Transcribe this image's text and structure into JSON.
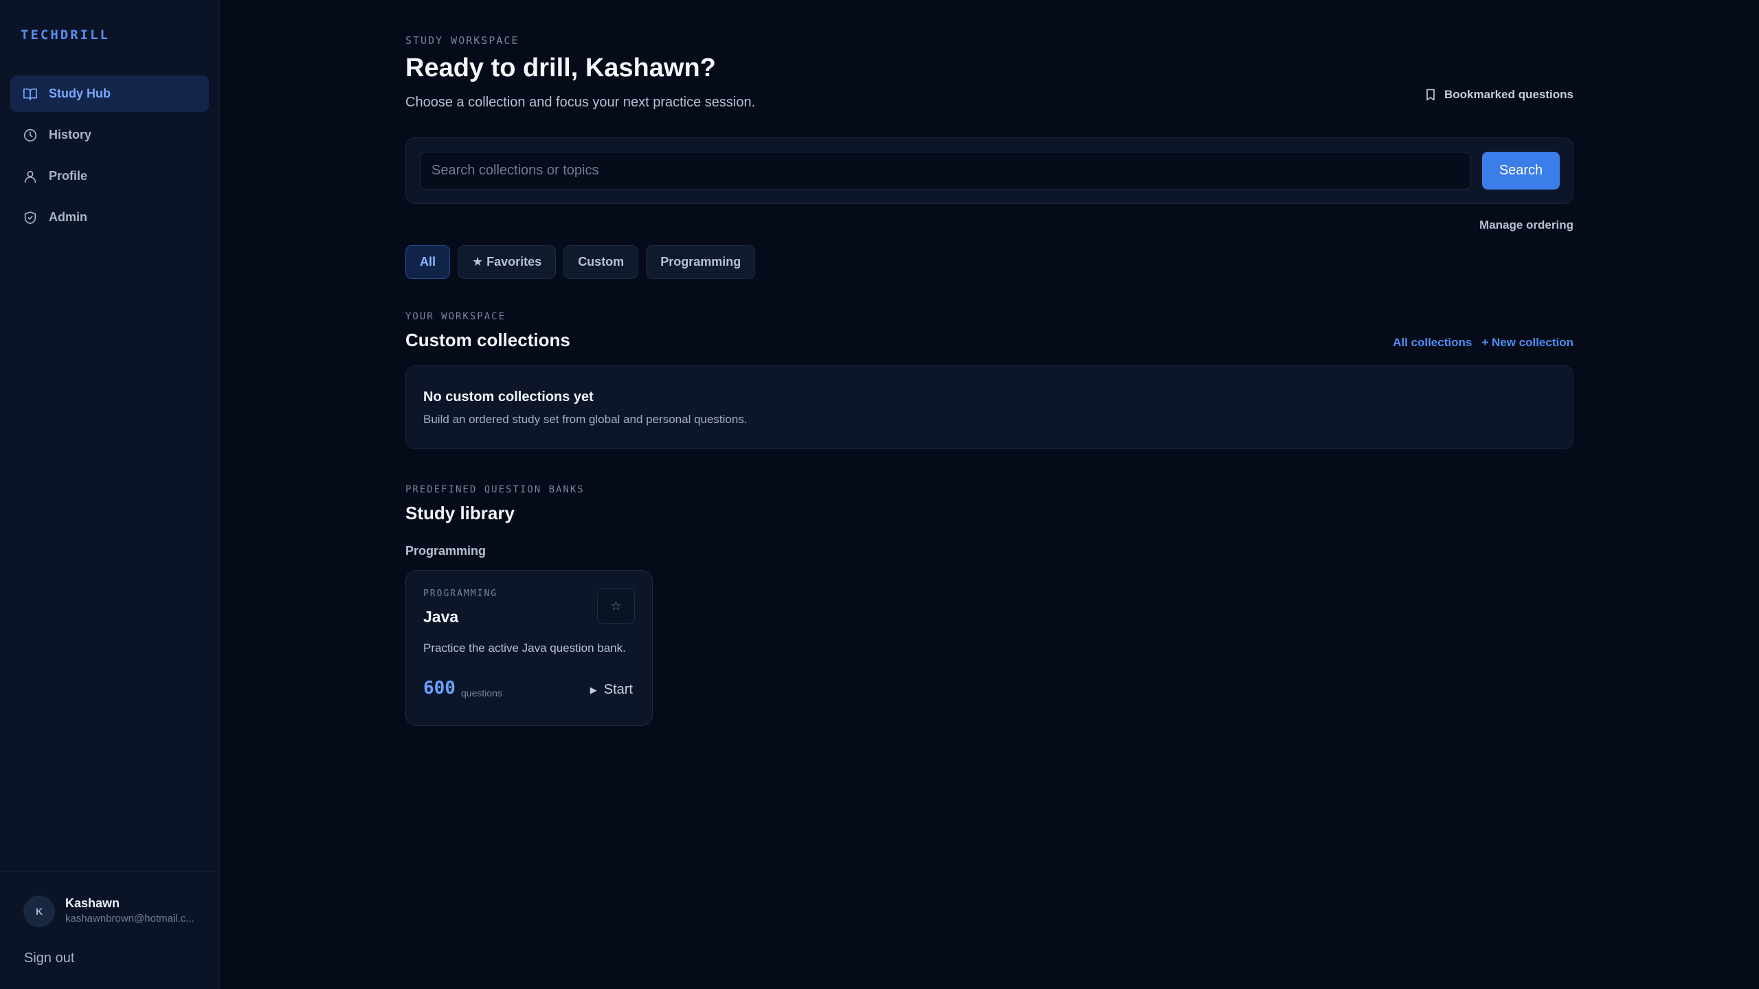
{
  "app": {
    "brand": "TECHDRILL"
  },
  "sidebar": {
    "items": [
      {
        "label": "Study Hub",
        "icon": "book-icon",
        "active": true
      },
      {
        "label": "History",
        "icon": "clock-icon",
        "active": false
      },
      {
        "label": "Profile",
        "icon": "user-icon",
        "active": false
      },
      {
        "label": "Admin",
        "icon": "shield-icon",
        "active": false
      }
    ],
    "user": {
      "initial": "K",
      "name": "Kashawn",
      "email": "kashawnbrown@hotmail.c..."
    },
    "signout_label": "Sign out"
  },
  "header": {
    "eyebrow": "STUDY WORKSPACE",
    "title": "Ready to drill, Kashawn?",
    "subtitle": "Choose a collection and focus your next practice session.",
    "bookmarked_label": "Bookmarked questions"
  },
  "search": {
    "placeholder": "Search collections or topics",
    "value": "",
    "button_label": "Search"
  },
  "manage_ordering_label": "Manage ordering",
  "filters": [
    {
      "label": "All",
      "active": true
    },
    {
      "label": "★ Favorites",
      "active": false
    },
    {
      "label": "Custom",
      "active": false
    },
    {
      "label": "Programming",
      "active": false
    }
  ],
  "workspace": {
    "eyebrow": "YOUR WORKSPACE",
    "title": "Custom collections",
    "all_collections_label": "All collections",
    "new_collection_label": "+ New collection",
    "empty_title": "No custom collections yet",
    "empty_description": "Build an ordered study set from global and personal questions."
  },
  "library": {
    "eyebrow": "PREDEFINED QUESTION BANKS",
    "title": "Study library",
    "group_label": "Programming",
    "cards": [
      {
        "category": "PROGRAMMING",
        "name": "Java",
        "description": "Practice the active Java question bank.",
        "count": "600",
        "count_label": "questions",
        "start_label": "Start"
      }
    ]
  },
  "colors": {
    "accent": "#3b7de9",
    "link": "#4f8ef5",
    "background": "#050b18",
    "sidebar": "#0b1426"
  }
}
